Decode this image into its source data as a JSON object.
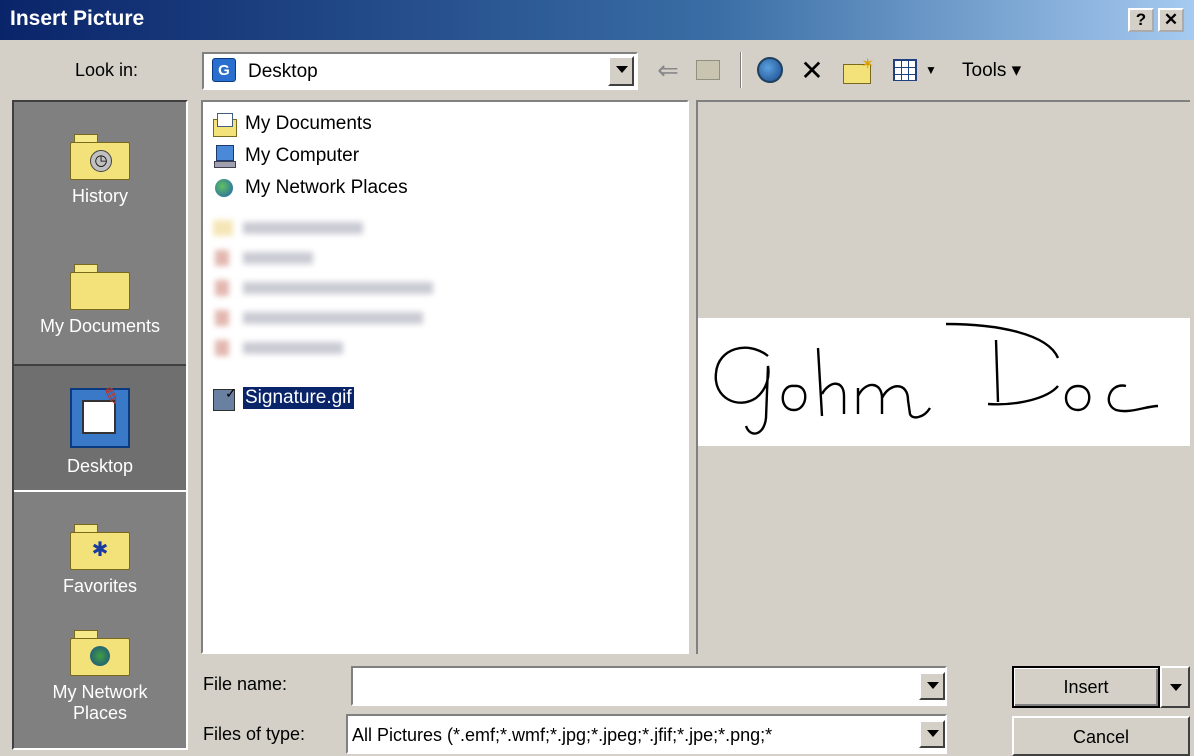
{
  "window": {
    "title": "Insert Picture",
    "help_label": "?",
    "close_label": "✕"
  },
  "lookin": {
    "label": "Look in:",
    "value": "Desktop"
  },
  "toolbar": {
    "tools_label": "Tools ▾"
  },
  "places": [
    {
      "label": "History",
      "icon": "history-folder-icon"
    },
    {
      "label": "My Documents",
      "icon": "documents-folder-icon"
    },
    {
      "label": "Desktop",
      "icon": "desktop-icon"
    },
    {
      "label": "Favorites",
      "icon": "favorites-folder-icon"
    },
    {
      "label": "My Network",
      "label2": "Places",
      "icon": "network-folder-icon"
    }
  ],
  "files": {
    "items": [
      {
        "label": "My Documents",
        "icon": "my-documents-icon"
      },
      {
        "label": "My Computer",
        "icon": "my-computer-icon"
      },
      {
        "label": "My Network Places",
        "icon": "network-places-icon"
      }
    ],
    "selected": {
      "label": "Signature.gif",
      "icon": "gif-image-icon"
    }
  },
  "preview": {
    "signature_text": "John Doe"
  },
  "filename": {
    "label": "File name:",
    "value": ""
  },
  "filetype": {
    "label": "Files of type:",
    "value": "All Pictures (*.emf;*.wmf;*.jpg;*.jpeg;*.jfif;*.jpe;*.png;*"
  },
  "buttons": {
    "insert": "Insert",
    "cancel": "Cancel"
  }
}
